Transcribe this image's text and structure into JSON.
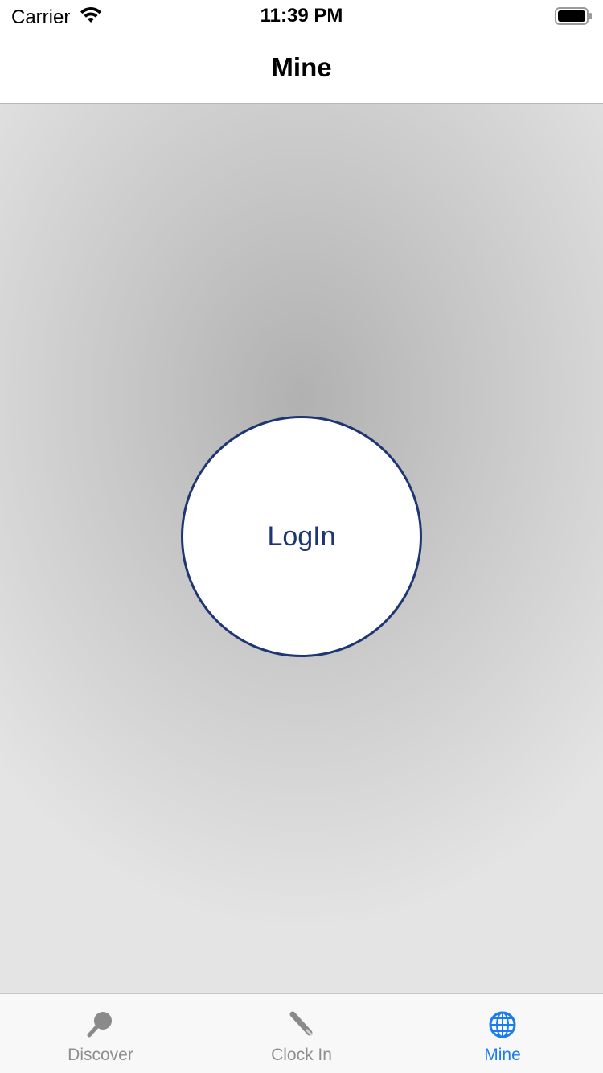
{
  "status_bar": {
    "carrier": "Carrier",
    "time": "11:39 PM",
    "icons": [
      "wifi-icon",
      "battery-icon"
    ]
  },
  "nav": {
    "title": "Mine"
  },
  "main": {
    "login_label": "LogIn"
  },
  "tabs": [
    {
      "label": "Discover",
      "icon": "search-icon",
      "active": false
    },
    {
      "label": "Clock In",
      "icon": "pen-icon",
      "active": false
    },
    {
      "label": "Mine",
      "icon": "globe-icon",
      "active": true
    }
  ],
  "colors": {
    "accent": "#1a7cf0",
    "login_border": "#1e3773",
    "inactive_tab": "#8e8e8e"
  }
}
